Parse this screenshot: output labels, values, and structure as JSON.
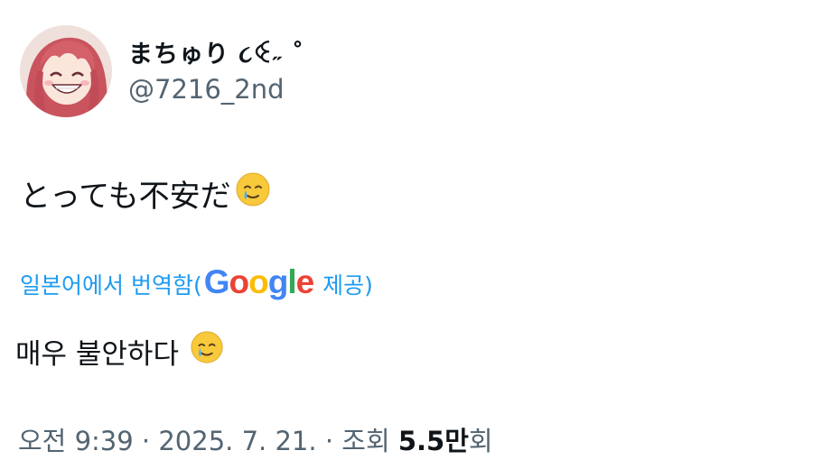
{
  "user": {
    "display_name": "まちゅり ૮ꒊ˶ ˚",
    "handle": "@7216_2nd"
  },
  "tweet": {
    "text": "とっても不安だ",
    "emoji": "face-holding-back-tears"
  },
  "translation": {
    "link_label": "일본어에서 번역함(",
    "provider": "Google",
    "provided_label": "제공)",
    "translated_text": "매우 불안하다"
  },
  "meta": {
    "time": "오전 9:39",
    "separator": " · ",
    "date": "2025. 7. 21.",
    "views_label": "조회",
    "views_number": "5.5",
    "views_unit": "만",
    "views_suffix": "회"
  },
  "colors": {
    "link": "#1d9bf0",
    "secondary_text": "#536471",
    "primary_text": "#0f1419",
    "google_blue": "#4285f4",
    "google_red": "#ea4335",
    "google_yellow": "#fbbc05",
    "google_green": "#34a853"
  }
}
